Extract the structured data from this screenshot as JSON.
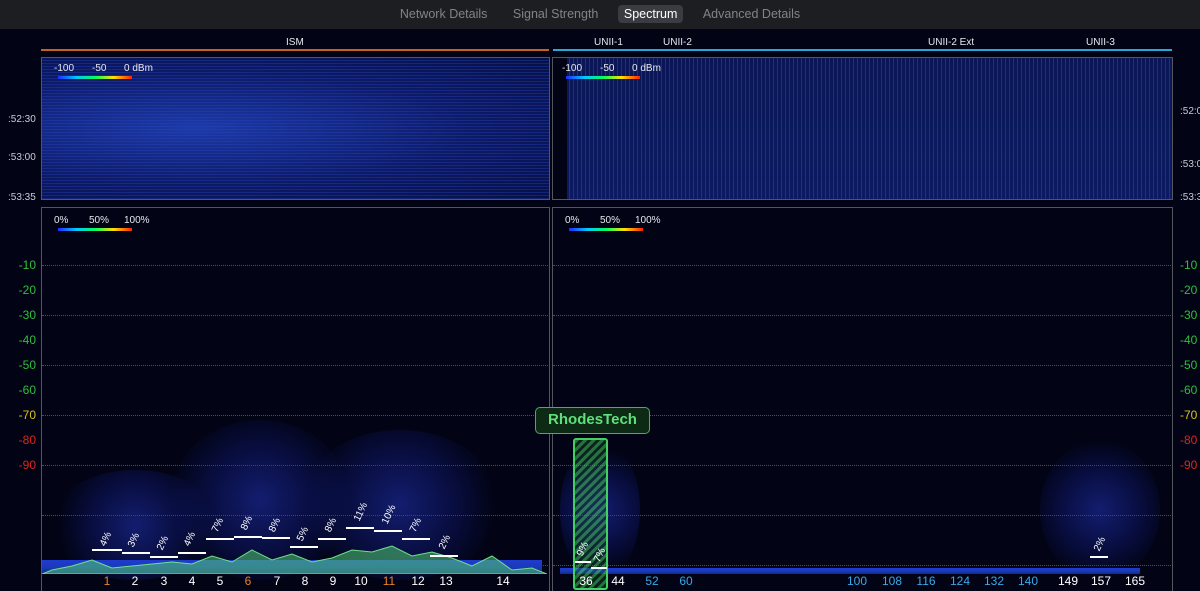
{
  "tabs": [
    {
      "label": "Network Details",
      "active": false
    },
    {
      "label": "Signal Strength",
      "active": false
    },
    {
      "label": "Spectrum",
      "active": true
    },
    {
      "label": "Advanced Details",
      "active": false
    }
  ],
  "bands": {
    "ism": "ISM",
    "unii1": "UNII-1",
    "unii2": "UNII-2",
    "unii2ext": "UNII-2 Ext",
    "unii3": "UNII-3",
    "ism_color": "#c8611e",
    "unii_color": "#2aa6d8"
  },
  "waterfall": {
    "legend": {
      "min": "-100",
      "mid": "-50",
      "max": "0 dBm"
    },
    "times_left": [
      ":52:30",
      ":53:00",
      ":53:35"
    ],
    "times_right": [
      ":52:0",
      ":53:0",
      ":53:3"
    ]
  },
  "spectrum": {
    "legend": {
      "min": "0%",
      "mid": "50%",
      "max": "100%"
    },
    "y_labels": [
      "-10",
      "-20",
      "-30",
      "-40",
      "-50",
      "-60",
      "-70",
      "-80",
      "-90"
    ],
    "y_colors": {
      "green": "#2fbf3a",
      "yellow": "#d8c21a",
      "red": "#e0231b"
    }
  },
  "network": {
    "name": "RhodesTech"
  },
  "channels_24": [
    {
      "label": "1",
      "color": "#e8822a"
    },
    {
      "label": "2",
      "color": "#ffffff"
    },
    {
      "label": "3",
      "color": "#ffffff"
    },
    {
      "label": "4",
      "color": "#ffffff"
    },
    {
      "label": "5",
      "color": "#ffffff"
    },
    {
      "label": "6",
      "color": "#e8822a"
    },
    {
      "label": "7",
      "color": "#ffffff"
    },
    {
      "label": "8",
      "color": "#ffffff"
    },
    {
      "label": "9",
      "color": "#ffffff"
    },
    {
      "label": "10",
      "color": "#ffffff"
    },
    {
      "label": "11",
      "color": "#e8822a"
    },
    {
      "label": "12",
      "color": "#ffffff"
    },
    {
      "label": "13",
      "color": "#ffffff"
    },
    {
      "label": "14",
      "color": "#ffffff"
    }
  ],
  "channels_5": [
    {
      "label": "36",
      "color": "#ffffff"
    },
    {
      "label": "44",
      "color": "#ffffff"
    },
    {
      "label": "52",
      "color": "#3aa8e8"
    },
    {
      "label": "60",
      "color": "#3aa8e8"
    },
    {
      "label": "100",
      "color": "#3aa8e8"
    },
    {
      "label": "108",
      "color": "#3aa8e8"
    },
    {
      "label": "116",
      "color": "#3aa8e8"
    },
    {
      "label": "124",
      "color": "#3aa8e8"
    },
    {
      "label": "132",
      "color": "#3aa8e8"
    },
    {
      "label": "140",
      "color": "#3aa8e8"
    },
    {
      "label": "149",
      "color": "#ffffff"
    },
    {
      "label": "157",
      "color": "#ffffff"
    },
    {
      "label": "165",
      "color": "#ffffff"
    }
  ],
  "utilization": {
    "ch1": "4%",
    "ch2": "3%",
    "ch3": "2%",
    "ch4": "4%",
    "ch5": "7%",
    "ch6": "8%",
    "ch7": "8%",
    "ch8": "5%",
    "ch9": "8%",
    "ch10": "11%",
    "ch11": "10%",
    "ch12": "7%",
    "ch13": "2%",
    "ch36": "9%",
    "ch40": "7%",
    "ch157": "2%"
  }
}
